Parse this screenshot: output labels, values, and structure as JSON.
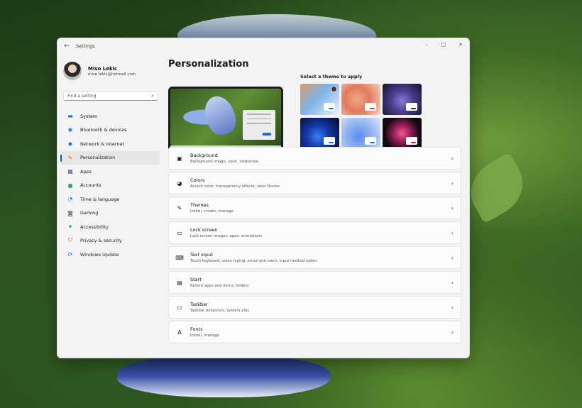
{
  "window": {
    "title": "Settings",
    "back_glyph": "←",
    "minimize_glyph": "–",
    "maximize_glyph": "□",
    "close_glyph": "✕"
  },
  "profile": {
    "name": "Miso Lekic",
    "email": "miso.lekic@hotmail.com"
  },
  "search": {
    "placeholder": "Find a setting",
    "icon": "search-icon",
    "glyph": "⌕"
  },
  "nav": {
    "active": "Personalization",
    "items": [
      {
        "label": "System",
        "icon": "monitor-icon",
        "glyph": "▬",
        "color": "#1e6fd9"
      },
      {
        "label": "Bluetooth & devices",
        "icon": "bluetooth-icon",
        "glyph": "✱",
        "color": "#1e6fd9"
      },
      {
        "label": "Network & internet",
        "icon": "wifi-icon",
        "glyph": "◆",
        "color": "#1e6fd9"
      },
      {
        "label": "Personalization",
        "icon": "brush-icon",
        "glyph": "✎",
        "color": "#e06a1f"
      },
      {
        "label": "Apps",
        "icon": "apps-icon",
        "glyph": "▦",
        "color": "#4a5f7a"
      },
      {
        "label": "Accounts",
        "icon": "person-icon",
        "glyph": "●",
        "color": "#2ba36b"
      },
      {
        "label": "Time & language",
        "icon": "globe-clock-icon",
        "glyph": "◔",
        "color": "#1e8ad9"
      },
      {
        "label": "Gaming",
        "icon": "controller-icon",
        "glyph": "◙",
        "color": "#7a7a7a"
      },
      {
        "label": "Accessibility",
        "icon": "accessibility-icon",
        "glyph": "✦",
        "color": "#1e6fd9"
      },
      {
        "label": "Privacy & security",
        "icon": "shield-icon",
        "glyph": "⛉",
        "color": "#7a7a7a"
      },
      {
        "label": "Windows Update",
        "icon": "update-icon",
        "glyph": "⟳",
        "color": "#1e6fd9"
      }
    ]
  },
  "page": {
    "title": "Personalization"
  },
  "themes": {
    "label": "Select a theme to apply",
    "items": [
      {
        "name": "theme-custom",
        "accent": "#1f6fd1",
        "bg": "linear-gradient(135deg,#d99c6a 0%,#7db3e8 45%,#eef3f8 100%)",
        "badge": true
      },
      {
        "name": "theme-glow-peach",
        "accent": "#c2412c",
        "bg": "radial-gradient(circle at 40% 50%,#f0a88a 0%,#e27a5c 45%,#f5d3c2 100%)",
        "badge": false
      },
      {
        "name": "theme-dark-purple",
        "accent": "#222222",
        "bg": "radial-gradient(circle at 50% 55%,#8c7ad6 0%,#4d3f94 40%,#141226 100%)",
        "badge": false
      },
      {
        "name": "theme-dark-blue",
        "accent": "#1f6fd1",
        "bg": "radial-gradient(circle at 45% 60%,#3b7ff5 0%,#1238a8 40%,#060a22 100%)",
        "badge": false
      },
      {
        "name": "theme-light-blue",
        "accent": "#1f6fd1",
        "bg": "radial-gradient(circle at 45% 60%,#5b8df2 0%,#8fb3ee 45%,#d9e5f7 100%)",
        "badge": false
      },
      {
        "name": "theme-flower",
        "accent": "#c2185b",
        "bg": "radial-gradient(circle at 50% 50%,#f25a8f 0%,#a4225e 30%,#120a12 70%)",
        "badge": false
      }
    ]
  },
  "settings": [
    {
      "title": "Background",
      "subtitle": "Background image, color, slideshow",
      "icon": "image-icon",
      "glyph": "▣"
    },
    {
      "title": "Colors",
      "subtitle": "Accent color, transparency effects, color theme",
      "icon": "palette-icon",
      "glyph": "◕"
    },
    {
      "title": "Themes",
      "subtitle": "Install, create, manage",
      "icon": "brush-icon",
      "glyph": "✎"
    },
    {
      "title": "Lock screen",
      "subtitle": "Lock screen images, apps, animations",
      "icon": "lock-screen-icon",
      "glyph": "▭"
    },
    {
      "title": "Text input",
      "subtitle": "Touch keyboard, voice typing, emoji and more, input method editor",
      "icon": "keyboard-icon",
      "glyph": "⌨"
    },
    {
      "title": "Start",
      "subtitle": "Recent apps and items, folders",
      "icon": "start-icon",
      "glyph": "▤"
    },
    {
      "title": "Taskbar",
      "subtitle": "Taskbar behaviors, system pins",
      "icon": "taskbar-icon",
      "glyph": "▭"
    },
    {
      "title": "Fonts",
      "subtitle": "Install, manage",
      "icon": "fonts-icon",
      "glyph": "A"
    }
  ],
  "chevron_glyph": "›"
}
